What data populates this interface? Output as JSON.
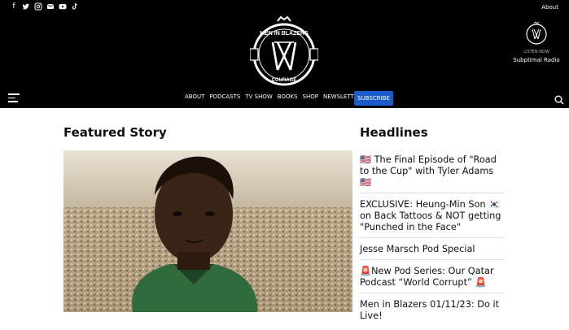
{
  "header": {
    "social_icons": [
      "facebook-icon",
      "twitter-icon",
      "instagram-icon",
      "email-icon",
      "youtube-icon",
      "tiktok-icon"
    ],
    "about_label": "About",
    "listen_now": "LISTEN NOW",
    "suboptimal_radio": "Subptimal Radio",
    "logo_text": "MEN IN BLAZERS",
    "logo_sub": "COURAGE"
  },
  "nav": {
    "items": [
      "ABOUT",
      "PODCASTS",
      "TV SHOW",
      "BOOKS",
      "SHOP",
      "NEWSLETTER"
    ],
    "subscribe": "SUBSCRIBE"
  },
  "main": {
    "featured_title": "Featured Story",
    "headlines_title": "Headlines",
    "headlines": [
      "🇺🇸 The Final Episode of \"Road to the Cup\" with Tyler Adams 🇺🇸",
      "EXCLUSIVE: Heung-Min Son 🇰🇷 on Back Tattoos & NOT getting \"Punched in the Face\"",
      "Jesse Marsch Pod Special",
      "🚨New Pod Series: Our Qatar Podcast “World Corrupt” 🚨",
      "Men in Blazers 01/11/23: Do it Live!"
    ]
  },
  "colors": {
    "header_bg": "#000000",
    "subscribe_bg": "#1a5ccc"
  }
}
